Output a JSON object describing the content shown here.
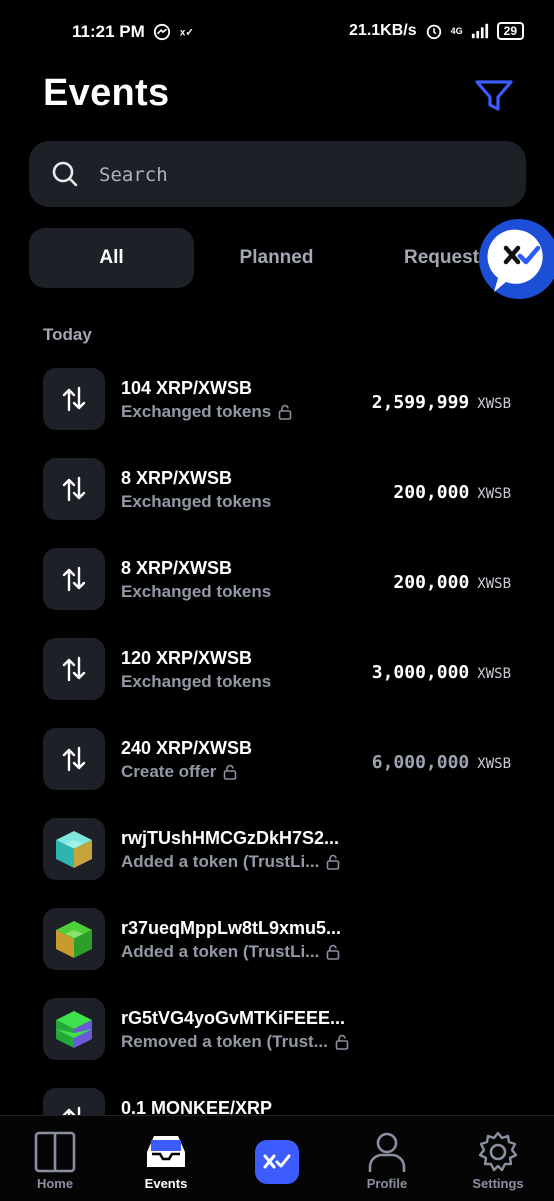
{
  "status_bar": {
    "time": "11:21 PM",
    "speed": "21.1KB/s",
    "network": "4G",
    "battery": "29"
  },
  "header": {
    "title": "Events"
  },
  "search": {
    "placeholder": "Search",
    "value": ""
  },
  "tabs": [
    {
      "label": "All",
      "active": true
    },
    {
      "label": "Planned",
      "active": false
    },
    {
      "label": "Request",
      "active": false
    }
  ],
  "section": {
    "label": "Today"
  },
  "events": [
    {
      "title": "104 XRP/XWSB",
      "subtitle": "Exchanged tokens",
      "locked": true,
      "amount": "2,599,999",
      "currency": "XWSB",
      "icon": "exchange-icon"
    },
    {
      "title": "8 XRP/XWSB",
      "subtitle": "Exchanged tokens",
      "locked": false,
      "amount": "200,000",
      "currency": "XWSB",
      "icon": "exchange-icon"
    },
    {
      "title": "8 XRP/XWSB",
      "subtitle": "Exchanged tokens",
      "locked": false,
      "amount": "200,000",
      "currency": "XWSB",
      "icon": "exchange-icon"
    },
    {
      "title": "120 XRP/XWSB",
      "subtitle": "Exchanged tokens",
      "locked": false,
      "amount": "3,000,000",
      "currency": "XWSB",
      "icon": "exchange-icon"
    },
    {
      "title": "240 XRP/XWSB",
      "subtitle": "Create offer",
      "locked": true,
      "amount": "6,000,000",
      "currency": "XWSB",
      "icon": "exchange-icon",
      "dim": true
    },
    {
      "title": "rwjTUshHMCGzDkH7S2...",
      "subtitle": "Added a token (TrustLi...",
      "locked": true,
      "amount": "",
      "currency": "",
      "icon": "token-cube-icon",
      "cube": [
        "#4fd1c5",
        "#c6a43c"
      ]
    },
    {
      "title": "r37ueqMppLw8tL9xmu5...",
      "subtitle": "Added a token (TrustLi...",
      "locked": true,
      "amount": "",
      "currency": "",
      "icon": "token-cube-icon",
      "cube": [
        "#c9a53a",
        "#3fbf3a"
      ]
    },
    {
      "title": "rG5tVG4yoGvMTKiFEEE...",
      "subtitle": "Removed a token (Trust...",
      "locked": true,
      "amount": "",
      "currency": "",
      "icon": "token-cube-icon",
      "cube": [
        "#3ee04c",
        "#6a5bd6"
      ]
    },
    {
      "title": "0.1 MONKEE/XRP",
      "subtitle": "",
      "locked": false,
      "amount": "",
      "currency": "",
      "icon": "exchange-icon"
    }
  ],
  "nav": [
    {
      "label": "Home",
      "icon": "home-icon",
      "active": false
    },
    {
      "label": "Events",
      "icon": "inbox-icon",
      "active": true
    },
    {
      "label": "",
      "icon": "xumm-scan-icon",
      "active": false
    },
    {
      "label": "Profile",
      "icon": "profile-icon",
      "active": false
    },
    {
      "label": "Settings",
      "icon": "settings-gear-icon",
      "active": false
    }
  ],
  "colors": {
    "accent": "#3d5cff",
    "background": "#000000",
    "surface": "#1d2027"
  }
}
